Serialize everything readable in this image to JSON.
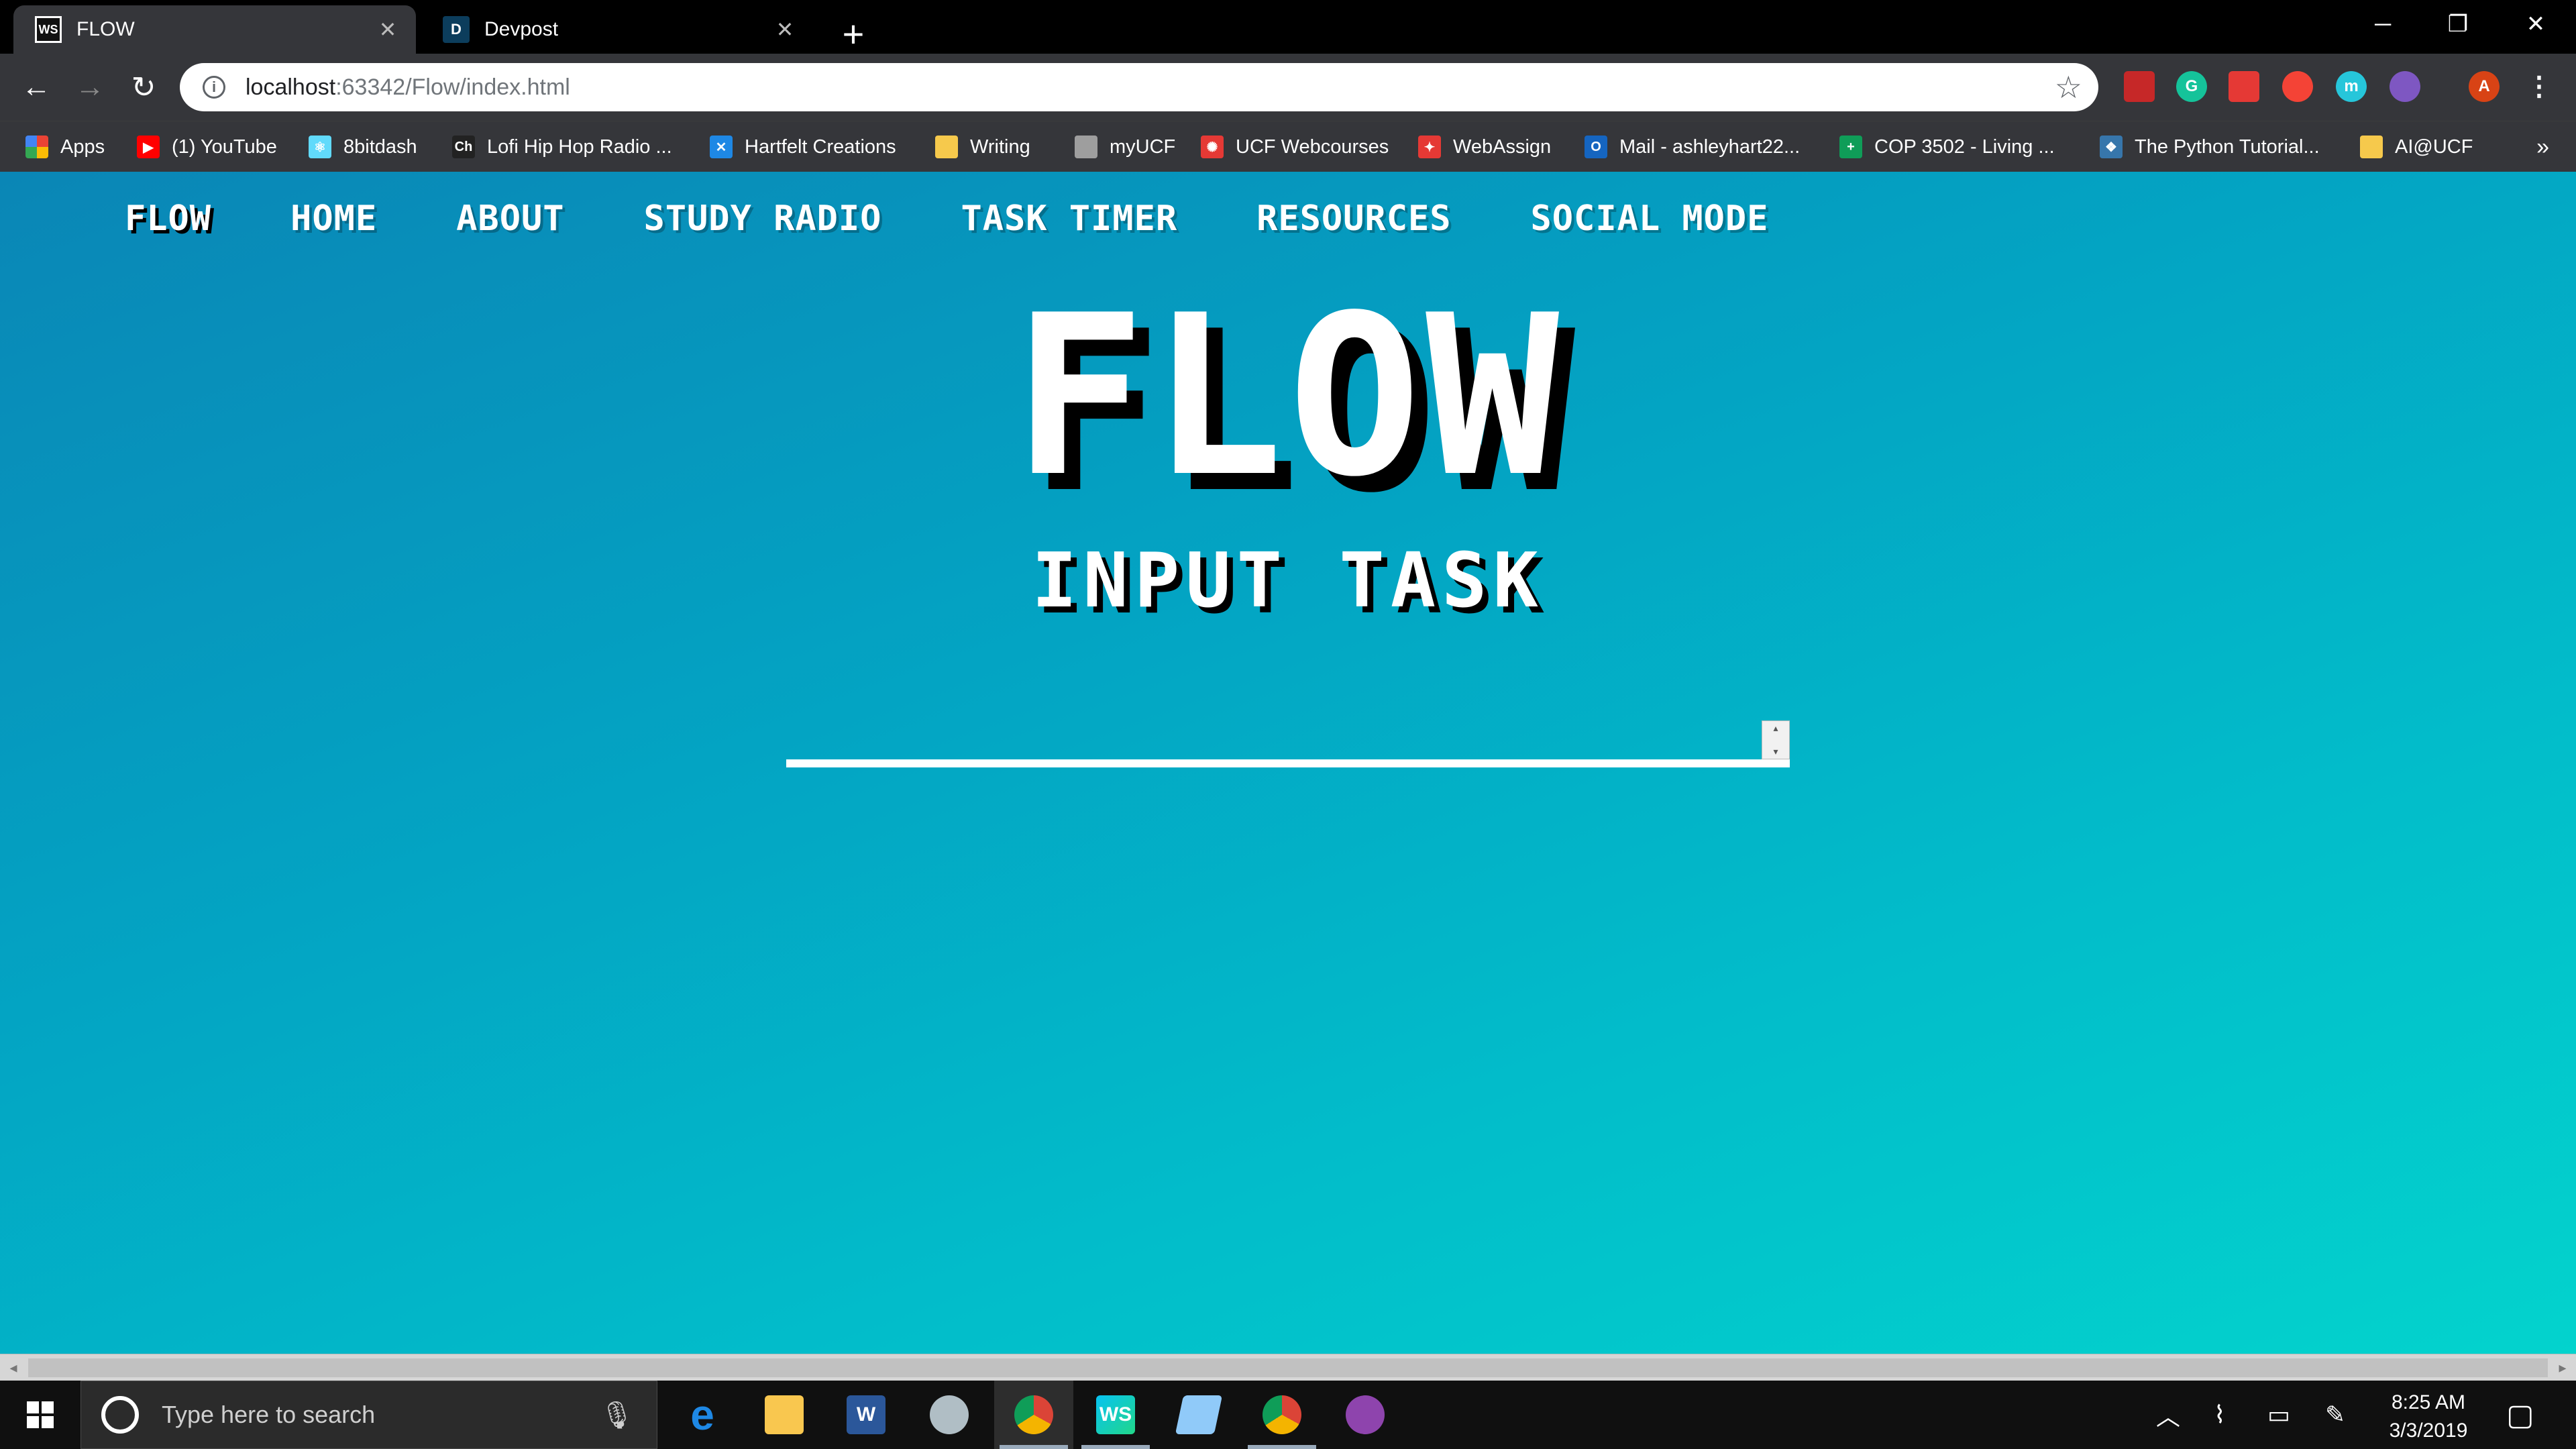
{
  "browser": {
    "tabs": [
      {
        "title": "FLOW",
        "favicon": "WS",
        "active": true
      },
      {
        "title": "Devpost",
        "favicon": "D",
        "active": false
      }
    ],
    "new_tab_label": "+",
    "url": {
      "host": "localhost",
      "rest": ":63342/Flow/index.html"
    },
    "extensions": [
      {
        "name": "pdf-extension-icon",
        "color": "#c62828"
      },
      {
        "name": "grammarly-icon",
        "label": "G",
        "color": "#15c39a"
      },
      {
        "name": "bookmark-extension-icon",
        "color": "#e53935"
      },
      {
        "name": "adblock-icon",
        "color": "#f44336"
      },
      {
        "name": "mercury-icon",
        "label": "m",
        "color": "#26c6da"
      },
      {
        "name": "link-extension-icon",
        "color": "#7e57c2"
      }
    ],
    "profile_initial": "A",
    "profile_color": "#d84315"
  },
  "bookmarks": [
    {
      "label": "Apps",
      "icon": "apps-grid-icon",
      "color": "#4285f4"
    },
    {
      "label": "(1) YouTube",
      "icon": "youtube-icon",
      "color": "#ff0000"
    },
    {
      "label": "8bitdash",
      "icon": "react-icon",
      "color": "#61dafb"
    },
    {
      "label": "Lofi Hip Hop Radio ...",
      "icon": "ch-icon",
      "color": "#222222"
    },
    {
      "label": "Hartfelt Creations",
      "icon": "hartfelt-icon",
      "color": "#1e88e5"
    },
    {
      "label": "Writing",
      "icon": "folder-icon",
      "color": "#f6c94c"
    },
    {
      "label": "myUCF",
      "icon": "page-icon",
      "color": "#9e9e9e"
    },
    {
      "label": "UCF Webcourses",
      "icon": "canvas-icon",
      "color": "#e53935"
    },
    {
      "label": "WebAssign",
      "icon": "webassign-icon",
      "color": "#e53935"
    },
    {
      "label": "Mail - ashleyhart22...",
      "icon": "outlook-icon",
      "color": "#1565c0"
    },
    {
      "label": "COP 3502 - Living ...",
      "icon": "sheets-icon",
      "color": "#0f9d58"
    },
    {
      "label": "The Python Tutorial...",
      "icon": "python-icon",
      "color": "#3776ab"
    },
    {
      "label": "AI@UCF",
      "icon": "folder-icon",
      "color": "#f6c94c"
    }
  ],
  "bookmarks_more": "»",
  "site": {
    "nav": [
      "FLOW",
      "HOME",
      "ABOUT",
      "STUDY RADIO",
      "TASK TIMER",
      "RESOURCES",
      "SOCIAL MODE"
    ],
    "hero_title": "FLOW",
    "subtitle": "INPUT TASK",
    "task_value": ""
  },
  "taskbar": {
    "search_placeholder": "Type here to search",
    "apps": [
      {
        "name": "edge-icon",
        "label": "e",
        "color": "#1e88e5",
        "state": "pinned"
      },
      {
        "name": "file-explorer-icon",
        "label": "",
        "color": "#f9c74f",
        "state": "pinned"
      },
      {
        "name": "word-icon",
        "label": "W",
        "color": "#2b579a",
        "state": "pinned"
      },
      {
        "name": "paint-icon",
        "label": "",
        "color": "#9e9e9e",
        "state": "pinned"
      },
      {
        "name": "chrome-icon",
        "label": "",
        "color": "#4caf50",
        "state": "focused"
      },
      {
        "name": "webstorm-icon",
        "label": "WS",
        "color": "#07c3f2",
        "state": "running"
      },
      {
        "name": "notepad-icon",
        "label": "",
        "color": "#90caf9",
        "state": "pinned"
      },
      {
        "name": "chrome-icon-2",
        "label": "",
        "color": "#4caf50",
        "state": "running"
      },
      {
        "name": "github-desktop-icon",
        "label": "",
        "color": "#8e44ad",
        "state": "pinned"
      }
    ],
    "time": "8:25 AM",
    "date": "3/3/2019"
  }
}
